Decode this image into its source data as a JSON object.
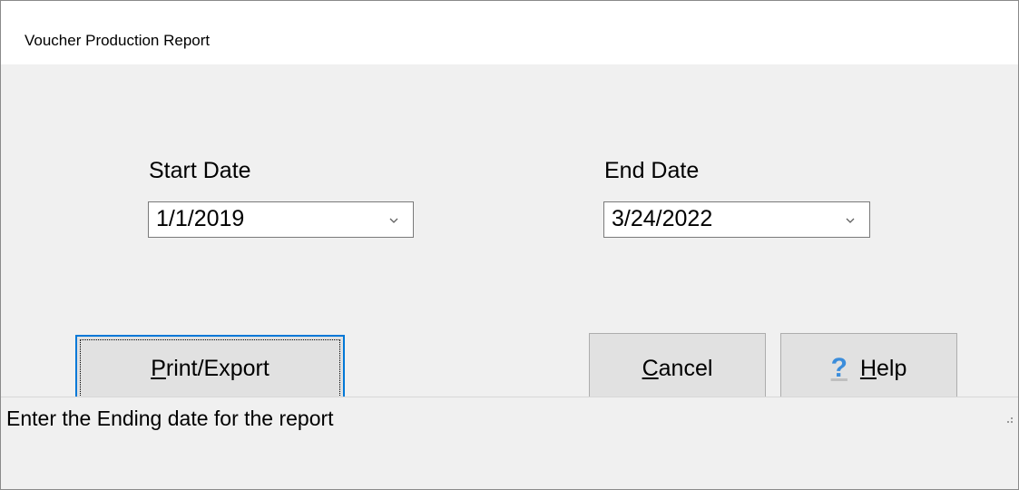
{
  "window": {
    "title": "Voucher Production Report"
  },
  "start_date": {
    "label": "Start Date",
    "value": "1/1/2019"
  },
  "end_date": {
    "label": "End Date",
    "value": "3/24/2022"
  },
  "buttons": {
    "print_export": {
      "mnemonic": "P",
      "rest": "rint/Export"
    },
    "cancel": {
      "mnemonic": "C",
      "rest": "ancel"
    },
    "help": {
      "icon_glyph": "?",
      "mnemonic": "H",
      "rest": "elp"
    }
  },
  "statusbar": {
    "text": "Enter the Ending date for the report"
  },
  "icons": {
    "dropdown": "chevron-down-icon",
    "help": "question-mark-icon",
    "size_grip": "size-grip-icon"
  },
  "colors": {
    "accent": "#0078d7",
    "help_icon": "#3b8ddb",
    "dialog_bg": "#f0f0f0",
    "button_bg": "#e1e1e1"
  }
}
